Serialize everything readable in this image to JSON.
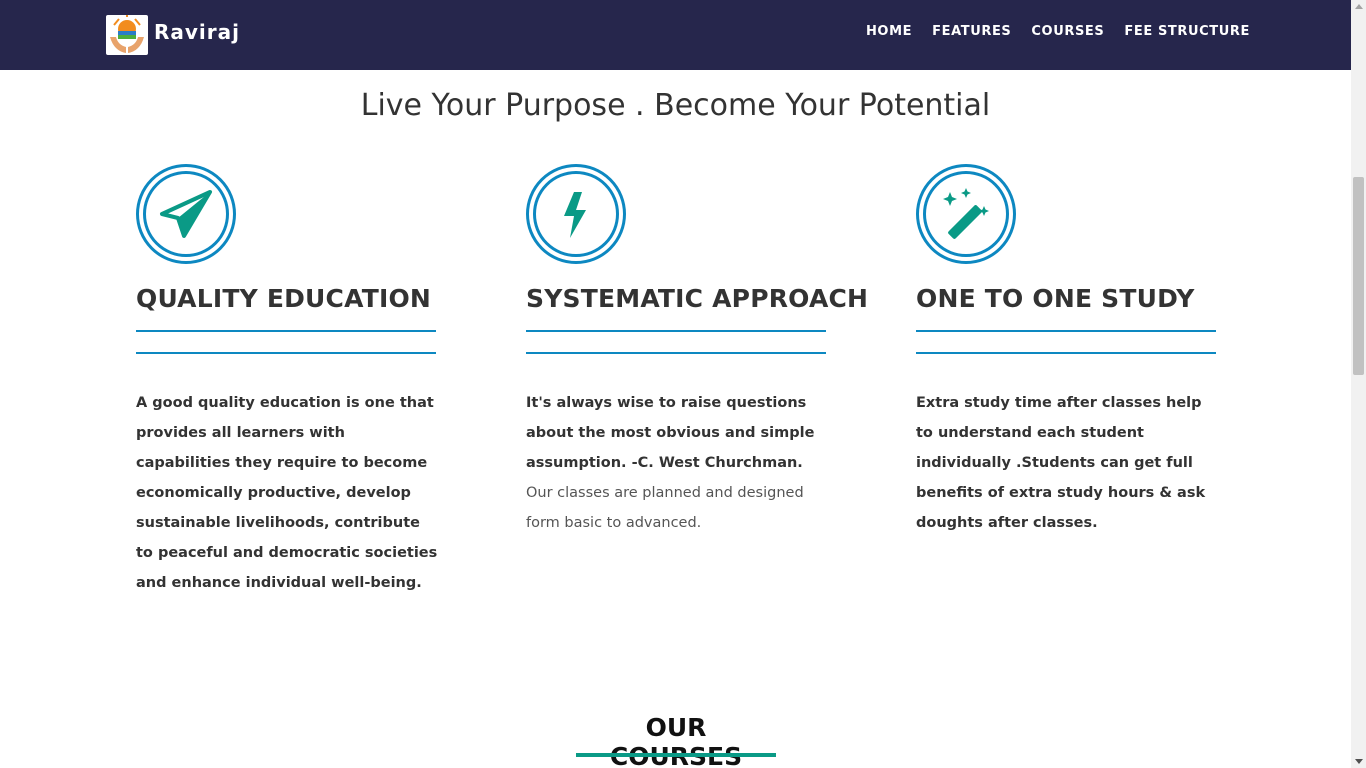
{
  "nav": {
    "brand": "Raviraj",
    "links": [
      "HOME",
      "FEATURES",
      "COURSES",
      "FEE STRUCTURE"
    ]
  },
  "tagline": "Live Your Purpose . Become Your Potential",
  "features": [
    {
      "icon": "paper-plane-icon",
      "title": "QUALITY EDUCATION",
      "body_bold": "A good quality education is one that provides all learners with capabilities they require to become economically productive, develop sustainable livelihoods, contribute to peaceful and democratic societies and enhance individual well-being.",
      "body_normal": ""
    },
    {
      "icon": "lightning-bolt-icon",
      "title": "SYSTEMATIC APPROACH",
      "body_bold": "It's always wise to raise questions about the most obvious and simple assumption. -C. West Churchman.",
      "body_normal": "Our classes are planned and designed form basic to advanced."
    },
    {
      "icon": "magic-wand-icon",
      "title": "ONE TO ONE STUDY",
      "body_bold": "Extra study time after classes help to understand each student individually .Students can get full benefits of extra study hours & ask doughts after classes.",
      "body_normal": ""
    }
  ],
  "courses": {
    "heading": "OUR COURSES"
  },
  "colors": {
    "navbar": "#26264c",
    "accent_blue": "#0d88c1",
    "icon_teal": "#0a9a86"
  }
}
